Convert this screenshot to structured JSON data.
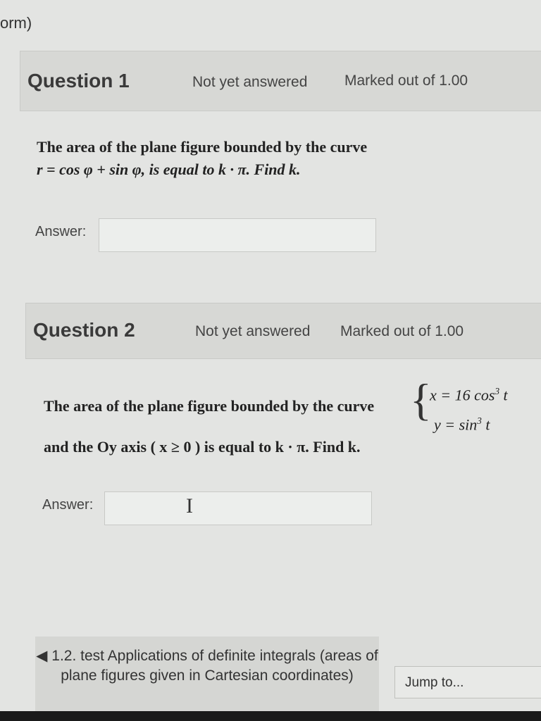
{
  "page": {
    "top_fragment": "orm)"
  },
  "question1": {
    "title": "Question 1",
    "status": "Not yet answered",
    "marks": "Marked out of 1.00",
    "text_line1": "The area of the plane figure bounded by the curve",
    "text_line2": "r = cos φ + sin φ, is equal to  k · π. Find k.",
    "answer_label": "Answer:",
    "answer_value": ""
  },
  "question2": {
    "title": "Question 2",
    "status": "Not yet answered",
    "marks": "Marked out of 1.00",
    "text_line1": "The area of the plane figure bounded by the curve",
    "eq1_prefix": "x = 16 cos",
    "eq1_power": "3",
    "eq1_var": " t",
    "eq2_prefix": "y = sin",
    "eq2_power": "3",
    "eq2_var": " t",
    "text_line2": "and the Oy axis ( x ≥ 0 ) is equal to  k · π. Find k.",
    "answer_label": "Answer:",
    "answer_value": ""
  },
  "navigation": {
    "prev_link_text": "◀ 1.2. test Applications of definite integrals (areas of plane figures given in Cartesian coordinates)",
    "jump_label": "Jump to..."
  },
  "icons": {
    "cursor": "text-cursor-icon"
  }
}
